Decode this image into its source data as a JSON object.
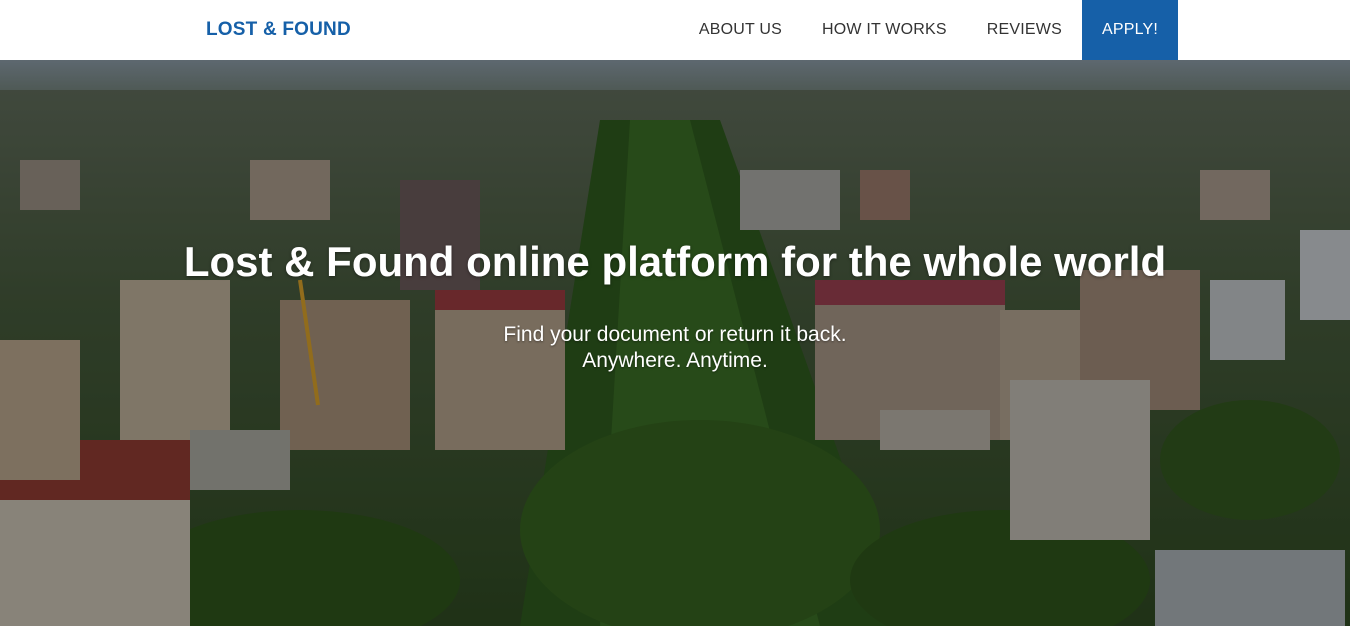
{
  "header": {
    "brand": "LOST & FOUND",
    "nav": [
      {
        "label": "ABOUT US"
      },
      {
        "label": "HOW IT WORKS"
      },
      {
        "label": "REVIEWS"
      }
    ],
    "apply_label": "APPLY!"
  },
  "hero": {
    "title": "Lost & Found online platform for the whole world",
    "subtitle_line1": "Find your document or return it back.",
    "subtitle_line2": "Anywhere. Anytime."
  },
  "colors": {
    "brand": "#1660a8",
    "nav_text": "#333333",
    "hero_text": "#ffffff"
  }
}
